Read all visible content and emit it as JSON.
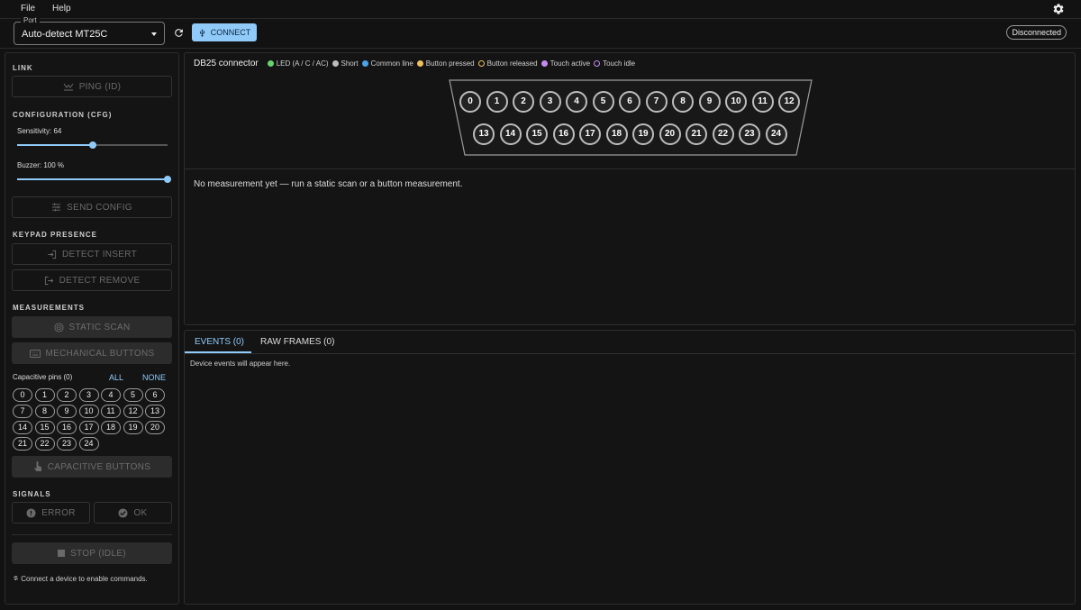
{
  "menu": {
    "file": "File",
    "help": "Help"
  },
  "toolbar": {
    "port_label": "Port",
    "port_value": "Auto-detect MT25C",
    "connect_label": "CONNECT",
    "status": "Disconnected"
  },
  "sidebar": {
    "link_title": "LINK",
    "ping_label": "PING (ID)",
    "config_title": "CONFIGURATION (CFG)",
    "sensitivity_label": "Sensitivity: 64",
    "sensitivity_fraction": 0.5,
    "buzzer_label": "Buzzer: 100 %",
    "buzzer_fraction": 1.0,
    "send_config_label": "SEND CONFIG",
    "keypad_title": "KEYPAD PRESENCE",
    "detect_insert_label": "DETECT INSERT",
    "detect_remove_label": "DETECT REMOVE",
    "measurements_title": "MEASUREMENTS",
    "static_scan_label": "STATIC SCAN",
    "mech_buttons_label": "MECHANICAL BUTTONS",
    "capacitive_label": "Capacitive pins (0)",
    "all_label": "ALL",
    "none_label": "NONE",
    "cap_pins": [
      "0",
      "1",
      "2",
      "3",
      "4",
      "5",
      "6",
      "7",
      "8",
      "9",
      "10",
      "11",
      "12",
      "13",
      "14",
      "15",
      "16",
      "17",
      "18",
      "19",
      "20",
      "21",
      "22",
      "23",
      "24"
    ],
    "cap_buttons_label": "CAPACITIVE BUTTONS",
    "signals_title": "SIGNALS",
    "error_label": "ERROR",
    "ok_label": "OK",
    "stop_label": "STOP (IDLE)",
    "hint": "Connect a device to enable commands."
  },
  "connector": {
    "title": "DB25 connector",
    "legend": [
      {
        "label": "LED (A / C / AC)",
        "color": "#66d46a",
        "style": "filled"
      },
      {
        "label": "Short",
        "color": "#bdbdbd",
        "style": "filled"
      },
      {
        "label": "Common line",
        "color": "#4aa3e8",
        "style": "filled"
      },
      {
        "label": "Button pressed",
        "color": "#f0c060",
        "style": "filled"
      },
      {
        "label": "Button released",
        "color": "#f0c060",
        "style": "ring"
      },
      {
        "label": "Touch active",
        "color": "#c58cf0",
        "style": "filled"
      },
      {
        "label": "Touch idle",
        "color": "#c58cf0",
        "style": "ring"
      }
    ],
    "row1": [
      "0",
      "1",
      "2",
      "3",
      "4",
      "5",
      "6",
      "7",
      "8",
      "9",
      "10",
      "11",
      "12"
    ],
    "row2": [
      "13",
      "14",
      "15",
      "16",
      "17",
      "18",
      "19",
      "20",
      "21",
      "22",
      "23",
      "24"
    ],
    "no_measurement": "No measurement yet — run a static scan or a button measurement."
  },
  "tabs": {
    "events_label": "EVENTS (0)",
    "raw_label": "RAW FRAMES (0)",
    "events_empty": "Device events will appear here."
  },
  "colors": {
    "accent": "#90caf9",
    "background": "#121212"
  }
}
